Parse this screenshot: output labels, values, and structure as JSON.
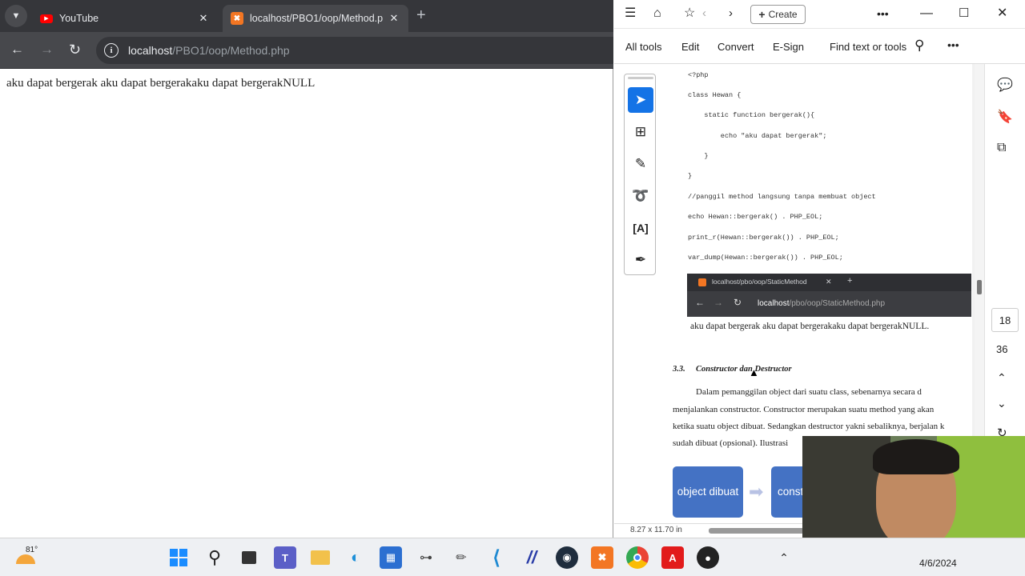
{
  "browser": {
    "tabs": [
      {
        "title": "YouTube"
      },
      {
        "title": "localhost/PBO1/oop/Method.p"
      }
    ],
    "address": {
      "host": "localhost",
      "path": "/PBO1/oop/Method.php"
    },
    "page_output": "aku dapat bergerak aku dapat bergerakaku dapat bergerakNULL"
  },
  "acrobat": {
    "create_label": "Create",
    "menu": [
      "All tools",
      "Edit",
      "Convert",
      "E-Sign",
      "Find text or tools"
    ],
    "code_lines": [
      "<?php",
      "class Hewan {",
      "    static function bergerak(){",
      "        echo \"aku dapat bergerak\";",
      "    }",
      "}",
      "//panggil method langsung tanpa membuat object",
      "echo Hewan::bergerak() . PHP_EOL;",
      "print_r(Hewan::bergerak()) . PHP_EOL;",
      "var_dump(Hewan::bergerak()) . PHP_EOL;"
    ],
    "embedded_shot": {
      "tab_title": "localhost/pbo/oop/StaticMethod",
      "url_host": "localhost",
      "url_path": "/pbo/oop/StaticMethod.php"
    },
    "output_text": "aku dapat bergerak aku dapat bergerakaku dapat bergerakNULL.",
    "section_number": "3.3.",
    "section_title": "Constructor dan Destructor",
    "paragraph_lines": [
      "Dalam pemanggilan object dari suatu class, sebenarnya secara d",
      "menjalankan constructor. Constructor merupakan suatu method yang akan",
      "ketika suatu object dibuat. Sedangkan destructor yakni sebaliknya, berjalan k",
      "sudah dibuat (opsional). Ilustrasi"
    ],
    "flow_boxes": [
      "object dibuat",
      "const"
    ],
    "page_number": "18",
    "page_total": "36",
    "page_size": "8.27 x 11.70 in"
  },
  "taskbar": {
    "weather": "81°",
    "date": "4/6/2024"
  }
}
